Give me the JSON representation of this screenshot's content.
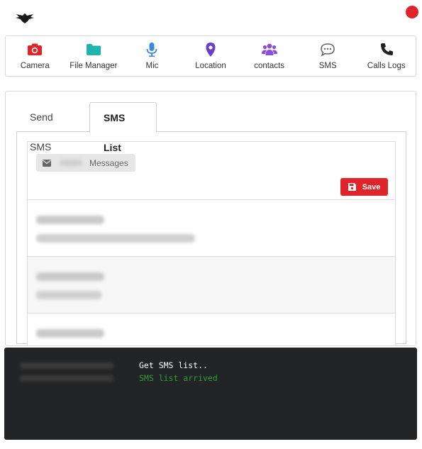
{
  "header": {
    "logo_icon": "eagle-logo-icon",
    "status_color": "#e0242b"
  },
  "toolbar": {
    "items": [
      {
        "label": "Camera",
        "icon": "camera-icon",
        "color": "#e0242b"
      },
      {
        "label": "File Manager",
        "icon": "folder-icon",
        "color": "#21b3b0"
      },
      {
        "label": "Mic",
        "icon": "microphone-icon",
        "color": "#3b8ad8"
      },
      {
        "label": "Location",
        "icon": "map-marker-icon",
        "color": "#6a3ec9"
      },
      {
        "label": "contacts",
        "icon": "users-icon",
        "color": "#8a4fd4"
      },
      {
        "label": "SMS",
        "icon": "comment-dots-icon",
        "color": "#666666"
      },
      {
        "label": "Calls Logs",
        "icon": "phone-icon",
        "color": "#222222"
      }
    ]
  },
  "tabs": {
    "send_label": "Send SMS",
    "list_label": "SMS List",
    "active": "SMS List"
  },
  "sms_panel": {
    "chip_label": "Messages",
    "chip_icon": "envelope-icon",
    "save_label": "Save",
    "save_icon": "floppy-disk-icon",
    "save_color": "#e0242b",
    "rows_note_redacted": true
  },
  "console": {
    "background": "#222426",
    "lines": [
      {
        "message": "Get SMS list..",
        "color": "#ffffff"
      },
      {
        "message": "SMS list arrived",
        "color": "#2e9e3a"
      }
    ]
  }
}
